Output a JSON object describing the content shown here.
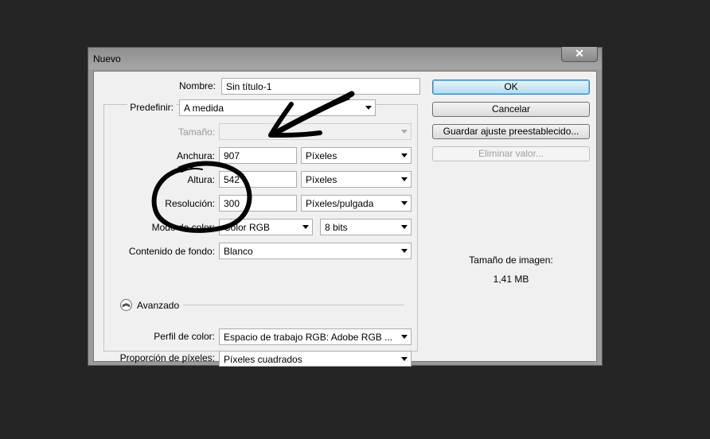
{
  "window": {
    "title": "Nuevo",
    "close_glyph": "✕"
  },
  "form": {
    "nombre": {
      "label": "Nombre:",
      "value": "Sin título-1"
    },
    "predefinir": {
      "label": "Predefinir:",
      "value": "A medida"
    },
    "tamano": {
      "label": "Tamaño:",
      "value": ""
    },
    "anchura": {
      "label": "Anchura:",
      "value": "907",
      "unit": "Píxeles"
    },
    "altura": {
      "label": "Altura:",
      "value": "542",
      "unit": "Píxeles"
    },
    "resolucion": {
      "label": "Resolución:",
      "value": "300",
      "unit": "Píxeles/pulgada"
    },
    "modo_color": {
      "label": "Modo de color:",
      "value": "Color RGB",
      "bits": "8 bits"
    },
    "contenido_fondo": {
      "label": "Contenido de fondo:",
      "value": "Blanco"
    },
    "avanzado": {
      "label": "Avanzado",
      "icon": "chevron-up-double-icon"
    },
    "perfil_color": {
      "label": "Perfil de color:",
      "value": "Espacio de trabajo RGB: Adobe RGB ..."
    },
    "proporcion_pixeles": {
      "label": "Proporción de píxeles:",
      "value": "Píxeles cuadrados"
    }
  },
  "buttons": {
    "ok": "OK",
    "cancelar": "Cancelar",
    "guardar_ajuste": "Guardar ajuste preestablecido...",
    "eliminar_valor": "Eliminar valor..."
  },
  "image_size": {
    "label": "Tamaño de imagen:",
    "value": "1,41 MB"
  },
  "colors": {
    "ok_button": "#b2dcf4",
    "annotation_ink": "#000000",
    "background": "#252525"
  }
}
